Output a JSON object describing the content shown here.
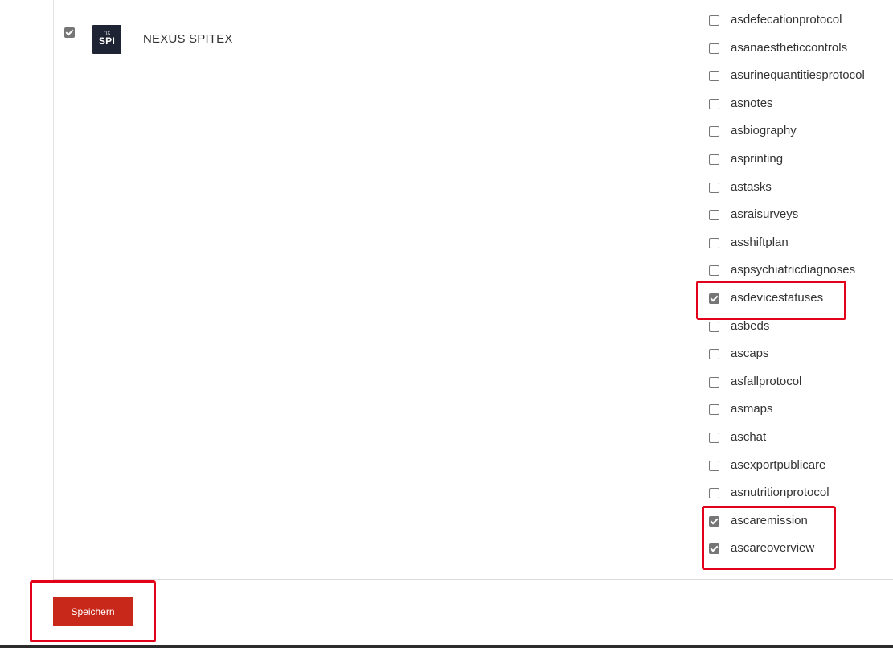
{
  "app": {
    "checked": true,
    "logo_small": "nx",
    "logo_big": "SPI",
    "name": "NEXUS SPITEX"
  },
  "modules": [
    {
      "label": "asdefecationprotocol",
      "checked": false
    },
    {
      "label": "asanaestheticcontrols",
      "checked": false
    },
    {
      "label": "asurinequantitiesprotocol",
      "checked": false
    },
    {
      "label": "asnotes",
      "checked": false
    },
    {
      "label": "asbiography",
      "checked": false
    },
    {
      "label": "asprinting",
      "checked": false
    },
    {
      "label": "astasks",
      "checked": false
    },
    {
      "label": "asraisurveys",
      "checked": false
    },
    {
      "label": "asshiftplan",
      "checked": false
    },
    {
      "label": "aspsychiatricdiagnoses",
      "checked": false
    },
    {
      "label": "asdevicestatuses",
      "checked": true
    },
    {
      "label": "asbeds",
      "checked": false
    },
    {
      "label": "ascaps",
      "checked": false
    },
    {
      "label": "asfallprotocol",
      "checked": false
    },
    {
      "label": "asmaps",
      "checked": false
    },
    {
      "label": "aschat",
      "checked": false
    },
    {
      "label": "asexportpublicare",
      "checked": false
    },
    {
      "label": "asnutritionprotocol",
      "checked": false
    },
    {
      "label": "ascaremission",
      "checked": true
    },
    {
      "label": "ascareoverview",
      "checked": true
    }
  ],
  "footer": {
    "save_label": "Speichern"
  },
  "colors": {
    "accent": "#c8281a",
    "highlight": "#e3001b",
    "logo_bg": "#1e2433"
  }
}
